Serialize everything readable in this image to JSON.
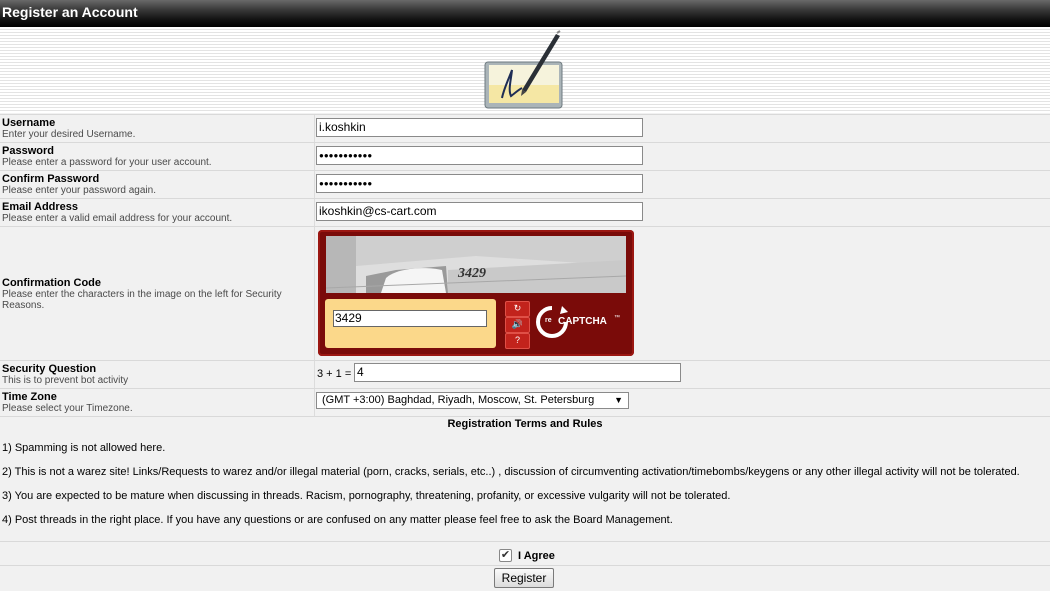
{
  "header": {
    "title": "Register an Account"
  },
  "icons": {
    "logo": "pen-signature-icon"
  },
  "fields": {
    "username": {
      "label": "Username",
      "desc": "Enter your desired Username.",
      "value": "i.koshkin"
    },
    "password": {
      "label": "Password",
      "desc": "Please enter a password for your user account.",
      "value": "●●●●●●●●●●●"
    },
    "confirm": {
      "label": "Confirm Password",
      "desc": "Please enter your password again.",
      "value": "●●●●●●●●●●●"
    },
    "email": {
      "label": "Email Address",
      "desc": "Please enter a valid email address for your account.",
      "value": "ikoshkin@cs-cart.com"
    },
    "confirmation": {
      "label": "Confirmation Code",
      "desc": "Please enter the characters in the image on the left for Security Reasons.",
      "captcha_text": "3429",
      "value": "3429",
      "brand_re": "re",
      "brand_word": "CAPTCHA",
      "brand_tm": "™",
      "buttons": {
        "refresh": "↻",
        "audio": "🔊",
        "help": "?"
      }
    },
    "security": {
      "label": "Security Question",
      "desc": "This is to prevent bot activity",
      "question": "3 + 1 =",
      "value": "4"
    },
    "timezone": {
      "label": "Time Zone",
      "desc": "Please select your Timezone.",
      "selected": "(GMT +3:00) Baghdad, Riyadh, Moscow, St. Petersburg",
      "arrow": "▼"
    }
  },
  "terms": {
    "title": "Registration Terms and Rules",
    "rules": [
      "1) Spamming is not allowed here.",
      "2) This is not a warez site! Links/Requests to warez and/or illegal material (porn, cracks, serials, etc..) , discussion of circumventing activation/timebombs/keygens or any other illegal activity will not be tolerated.",
      "3) You are expected to be mature when discussing in threads. Racism, pornography, threatening, profanity, or excessive vulgarity will not be tolerated.",
      "4) Post threads in the right place. If you have any questions or are confused on any matter please feel free to ask the Board Management."
    ]
  },
  "agree": {
    "label": "I Agree",
    "checked": true,
    "mark": "✔"
  },
  "submit": {
    "label": "Register"
  }
}
